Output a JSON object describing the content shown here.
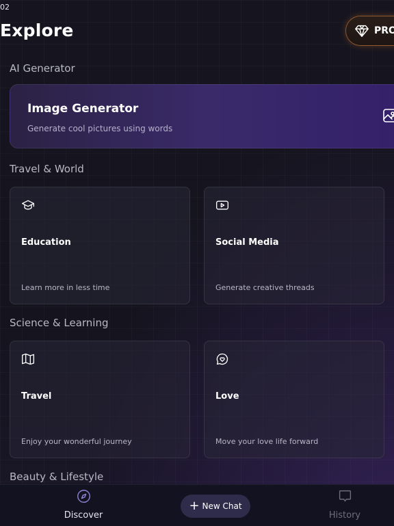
{
  "status": {
    "time": "02"
  },
  "header": {
    "title": "Explore",
    "pro_label": "PRO"
  },
  "sections": [
    {
      "title": "AI Generator"
    },
    {
      "title": "Travel & World"
    },
    {
      "title": "Science & Learning"
    },
    {
      "title": "Beauty & Lifestyle"
    }
  ],
  "hero": {
    "title": "Image Generator",
    "subtitle": "Generate cool pictures using words",
    "icon": "image-icon"
  },
  "cards": [
    {
      "title": "Education",
      "subtitle": "Learn more in less time",
      "icon": "graduation-cap-icon"
    },
    {
      "title": "Social Media",
      "subtitle": "Generate creative threads",
      "icon": "youtube-icon"
    },
    {
      "title": "Travel",
      "subtitle": "Enjoy your wonderful journey",
      "icon": "map-icon"
    },
    {
      "title": "Love",
      "subtitle": "Move your love life forward",
      "icon": "heart-chat-icon"
    }
  ],
  "tabbar": {
    "discover_label": "Discover",
    "new_chat_label": "New Chat",
    "history_label": "History",
    "active_color": "#8b86d6",
    "inactive_color": "#6f6e7c"
  },
  "colors": {
    "accent_purple": "#3a2a6a",
    "pro_glow": "#c8702a"
  }
}
